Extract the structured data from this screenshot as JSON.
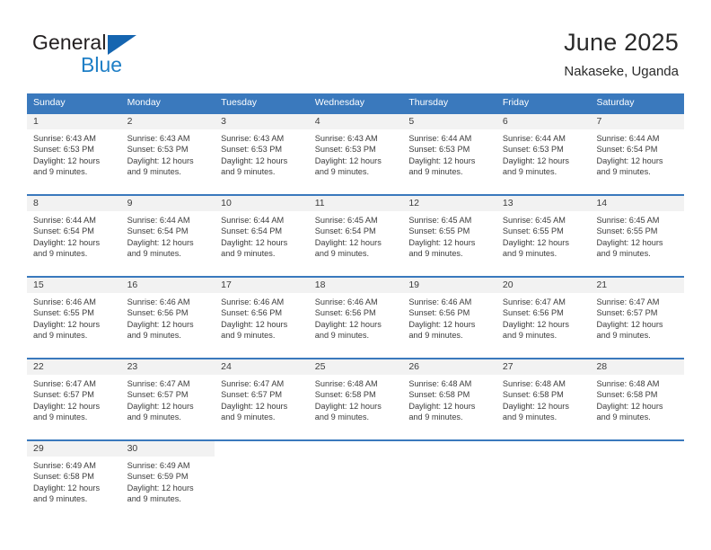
{
  "brand": {
    "name_top": "General",
    "name_bottom": "Blue",
    "triangle_color": "#1565b0",
    "blue_color": "#1f7fc6"
  },
  "header": {
    "title": "June 2025",
    "subtitle": "Nakaseke, Uganda"
  },
  "theme": {
    "header_blue": "#3a79bd",
    "date_band_gray": "#f2f2f2",
    "text_color": "#3c3c3c"
  },
  "weekdays": [
    "Sunday",
    "Monday",
    "Tuesday",
    "Wednesday",
    "Thursday",
    "Friday",
    "Saturday"
  ],
  "weeks": [
    {
      "days": [
        {
          "date": "1",
          "sunrise": "Sunrise: 6:43 AM",
          "sunset": "Sunset: 6:53 PM",
          "daylight": "Daylight: 12 hours and 9 minutes."
        },
        {
          "date": "2",
          "sunrise": "Sunrise: 6:43 AM",
          "sunset": "Sunset: 6:53 PM",
          "daylight": "Daylight: 12 hours and 9 minutes."
        },
        {
          "date": "3",
          "sunrise": "Sunrise: 6:43 AM",
          "sunset": "Sunset: 6:53 PM",
          "daylight": "Daylight: 12 hours and 9 minutes."
        },
        {
          "date": "4",
          "sunrise": "Sunrise: 6:43 AM",
          "sunset": "Sunset: 6:53 PM",
          "daylight": "Daylight: 12 hours and 9 minutes."
        },
        {
          "date": "5",
          "sunrise": "Sunrise: 6:44 AM",
          "sunset": "Sunset: 6:53 PM",
          "daylight": "Daylight: 12 hours and 9 minutes."
        },
        {
          "date": "6",
          "sunrise": "Sunrise: 6:44 AM",
          "sunset": "Sunset: 6:53 PM",
          "daylight": "Daylight: 12 hours and 9 minutes."
        },
        {
          "date": "7",
          "sunrise": "Sunrise: 6:44 AM",
          "sunset": "Sunset: 6:54 PM",
          "daylight": "Daylight: 12 hours and 9 minutes."
        }
      ]
    },
    {
      "days": [
        {
          "date": "8",
          "sunrise": "Sunrise: 6:44 AM",
          "sunset": "Sunset: 6:54 PM",
          "daylight": "Daylight: 12 hours and 9 minutes."
        },
        {
          "date": "9",
          "sunrise": "Sunrise: 6:44 AM",
          "sunset": "Sunset: 6:54 PM",
          "daylight": "Daylight: 12 hours and 9 minutes."
        },
        {
          "date": "10",
          "sunrise": "Sunrise: 6:44 AM",
          "sunset": "Sunset: 6:54 PM",
          "daylight": "Daylight: 12 hours and 9 minutes."
        },
        {
          "date": "11",
          "sunrise": "Sunrise: 6:45 AM",
          "sunset": "Sunset: 6:54 PM",
          "daylight": "Daylight: 12 hours and 9 minutes."
        },
        {
          "date": "12",
          "sunrise": "Sunrise: 6:45 AM",
          "sunset": "Sunset: 6:55 PM",
          "daylight": "Daylight: 12 hours and 9 minutes."
        },
        {
          "date": "13",
          "sunrise": "Sunrise: 6:45 AM",
          "sunset": "Sunset: 6:55 PM",
          "daylight": "Daylight: 12 hours and 9 minutes."
        },
        {
          "date": "14",
          "sunrise": "Sunrise: 6:45 AM",
          "sunset": "Sunset: 6:55 PM",
          "daylight": "Daylight: 12 hours and 9 minutes."
        }
      ]
    },
    {
      "days": [
        {
          "date": "15",
          "sunrise": "Sunrise: 6:46 AM",
          "sunset": "Sunset: 6:55 PM",
          "daylight": "Daylight: 12 hours and 9 minutes."
        },
        {
          "date": "16",
          "sunrise": "Sunrise: 6:46 AM",
          "sunset": "Sunset: 6:56 PM",
          "daylight": "Daylight: 12 hours and 9 minutes."
        },
        {
          "date": "17",
          "sunrise": "Sunrise: 6:46 AM",
          "sunset": "Sunset: 6:56 PM",
          "daylight": "Daylight: 12 hours and 9 minutes."
        },
        {
          "date": "18",
          "sunrise": "Sunrise: 6:46 AM",
          "sunset": "Sunset: 6:56 PM",
          "daylight": "Daylight: 12 hours and 9 minutes."
        },
        {
          "date": "19",
          "sunrise": "Sunrise: 6:46 AM",
          "sunset": "Sunset: 6:56 PM",
          "daylight": "Daylight: 12 hours and 9 minutes."
        },
        {
          "date": "20",
          "sunrise": "Sunrise: 6:47 AM",
          "sunset": "Sunset: 6:56 PM",
          "daylight": "Daylight: 12 hours and 9 minutes."
        },
        {
          "date": "21",
          "sunrise": "Sunrise: 6:47 AM",
          "sunset": "Sunset: 6:57 PM",
          "daylight": "Daylight: 12 hours and 9 minutes."
        }
      ]
    },
    {
      "days": [
        {
          "date": "22",
          "sunrise": "Sunrise: 6:47 AM",
          "sunset": "Sunset: 6:57 PM",
          "daylight": "Daylight: 12 hours and 9 minutes."
        },
        {
          "date": "23",
          "sunrise": "Sunrise: 6:47 AM",
          "sunset": "Sunset: 6:57 PM",
          "daylight": "Daylight: 12 hours and 9 minutes."
        },
        {
          "date": "24",
          "sunrise": "Sunrise: 6:47 AM",
          "sunset": "Sunset: 6:57 PM",
          "daylight": "Daylight: 12 hours and 9 minutes."
        },
        {
          "date": "25",
          "sunrise": "Sunrise: 6:48 AM",
          "sunset": "Sunset: 6:58 PM",
          "daylight": "Daylight: 12 hours and 9 minutes."
        },
        {
          "date": "26",
          "sunrise": "Sunrise: 6:48 AM",
          "sunset": "Sunset: 6:58 PM",
          "daylight": "Daylight: 12 hours and 9 minutes."
        },
        {
          "date": "27",
          "sunrise": "Sunrise: 6:48 AM",
          "sunset": "Sunset: 6:58 PM",
          "daylight": "Daylight: 12 hours and 9 minutes."
        },
        {
          "date": "28",
          "sunrise": "Sunrise: 6:48 AM",
          "sunset": "Sunset: 6:58 PM",
          "daylight": "Daylight: 12 hours and 9 minutes."
        }
      ]
    },
    {
      "days": [
        {
          "date": "29",
          "sunrise": "Sunrise: 6:49 AM",
          "sunset": "Sunset: 6:58 PM",
          "daylight": "Daylight: 12 hours and 9 minutes."
        },
        {
          "date": "30",
          "sunrise": "Sunrise: 6:49 AM",
          "sunset": "Sunset: 6:59 PM",
          "daylight": "Daylight: 12 hours and 9 minutes."
        },
        {
          "date": "",
          "sunrise": "",
          "sunset": "",
          "daylight": ""
        },
        {
          "date": "",
          "sunrise": "",
          "sunset": "",
          "daylight": ""
        },
        {
          "date": "",
          "sunrise": "",
          "sunset": "",
          "daylight": ""
        },
        {
          "date": "",
          "sunrise": "",
          "sunset": "",
          "daylight": ""
        },
        {
          "date": "",
          "sunrise": "",
          "sunset": "",
          "daylight": ""
        }
      ]
    }
  ]
}
